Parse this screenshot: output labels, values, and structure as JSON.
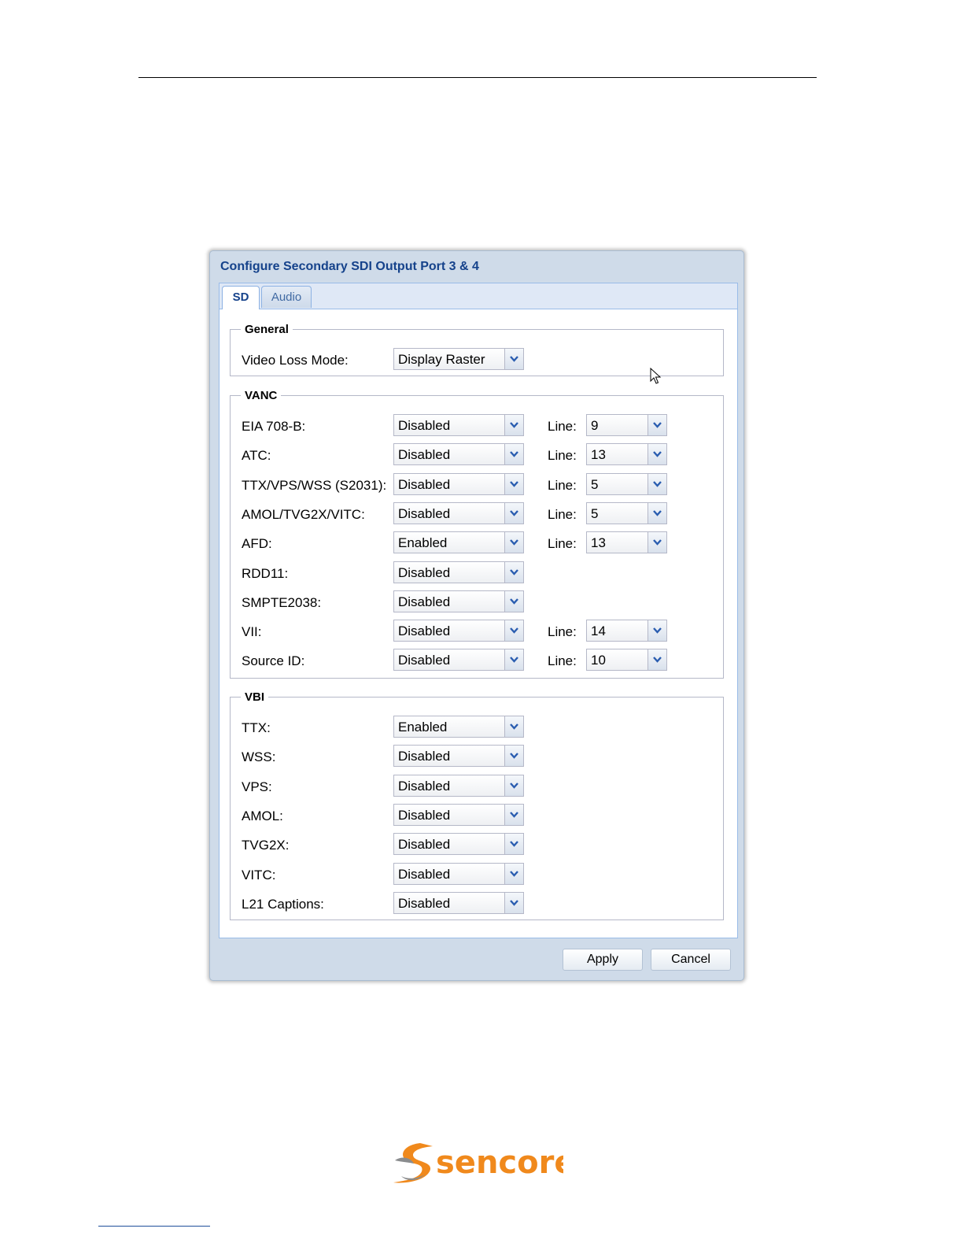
{
  "dialog": {
    "title": "Configure Secondary SDI Output Port 3 & 4",
    "tabs": [
      {
        "label": "SD",
        "active": true
      },
      {
        "label": "Audio",
        "active": false
      }
    ],
    "line_label": "Line:",
    "general": {
      "legend": "General",
      "rows": [
        {
          "label": "Video Loss Mode:",
          "value": "Display Raster"
        }
      ]
    },
    "vanc": {
      "legend": "VANC",
      "rows": [
        {
          "label": "EIA 708-B:",
          "value": "Disabled",
          "line": "9"
        },
        {
          "label": "ATC:",
          "value": "Disabled",
          "line": "13"
        },
        {
          "label": "TTX/VPS/WSS (S2031):",
          "value": "Disabled",
          "line": "5"
        },
        {
          "label": "AMOL/TVG2X/VITC:",
          "value": "Disabled",
          "line": "5"
        },
        {
          "label": "AFD:",
          "value": "Enabled",
          "line": "13"
        },
        {
          "label": "RDD11:",
          "value": "Disabled"
        },
        {
          "label": "SMPTE2038:",
          "value": "Disabled"
        },
        {
          "label": "VII:",
          "value": "Disabled",
          "line": "14"
        },
        {
          "label": "Source ID:",
          "value": "Disabled",
          "line": "10"
        }
      ]
    },
    "vbi": {
      "legend": "VBI",
      "rows": [
        {
          "label": "TTX:",
          "value": "Enabled"
        },
        {
          "label": "WSS:",
          "value": "Disabled"
        },
        {
          "label": "VPS:",
          "value": "Disabled"
        },
        {
          "label": "AMOL:",
          "value": "Disabled"
        },
        {
          "label": "TVG2X:",
          "value": "Disabled"
        },
        {
          "label": "VITC:",
          "value": "Disabled"
        },
        {
          "label": "L21 Captions:",
          "value": "Disabled"
        }
      ]
    },
    "buttons": {
      "apply": "Apply",
      "cancel": "Cancel"
    }
  },
  "logo": {
    "text": "sencore",
    "color": "#f0891c",
    "swoosh_color": "#8a8c8e"
  },
  "colors": {
    "title": "#15428b",
    "dialog_bg": "#cfdbe9",
    "tab_border": "#99bbe8"
  }
}
